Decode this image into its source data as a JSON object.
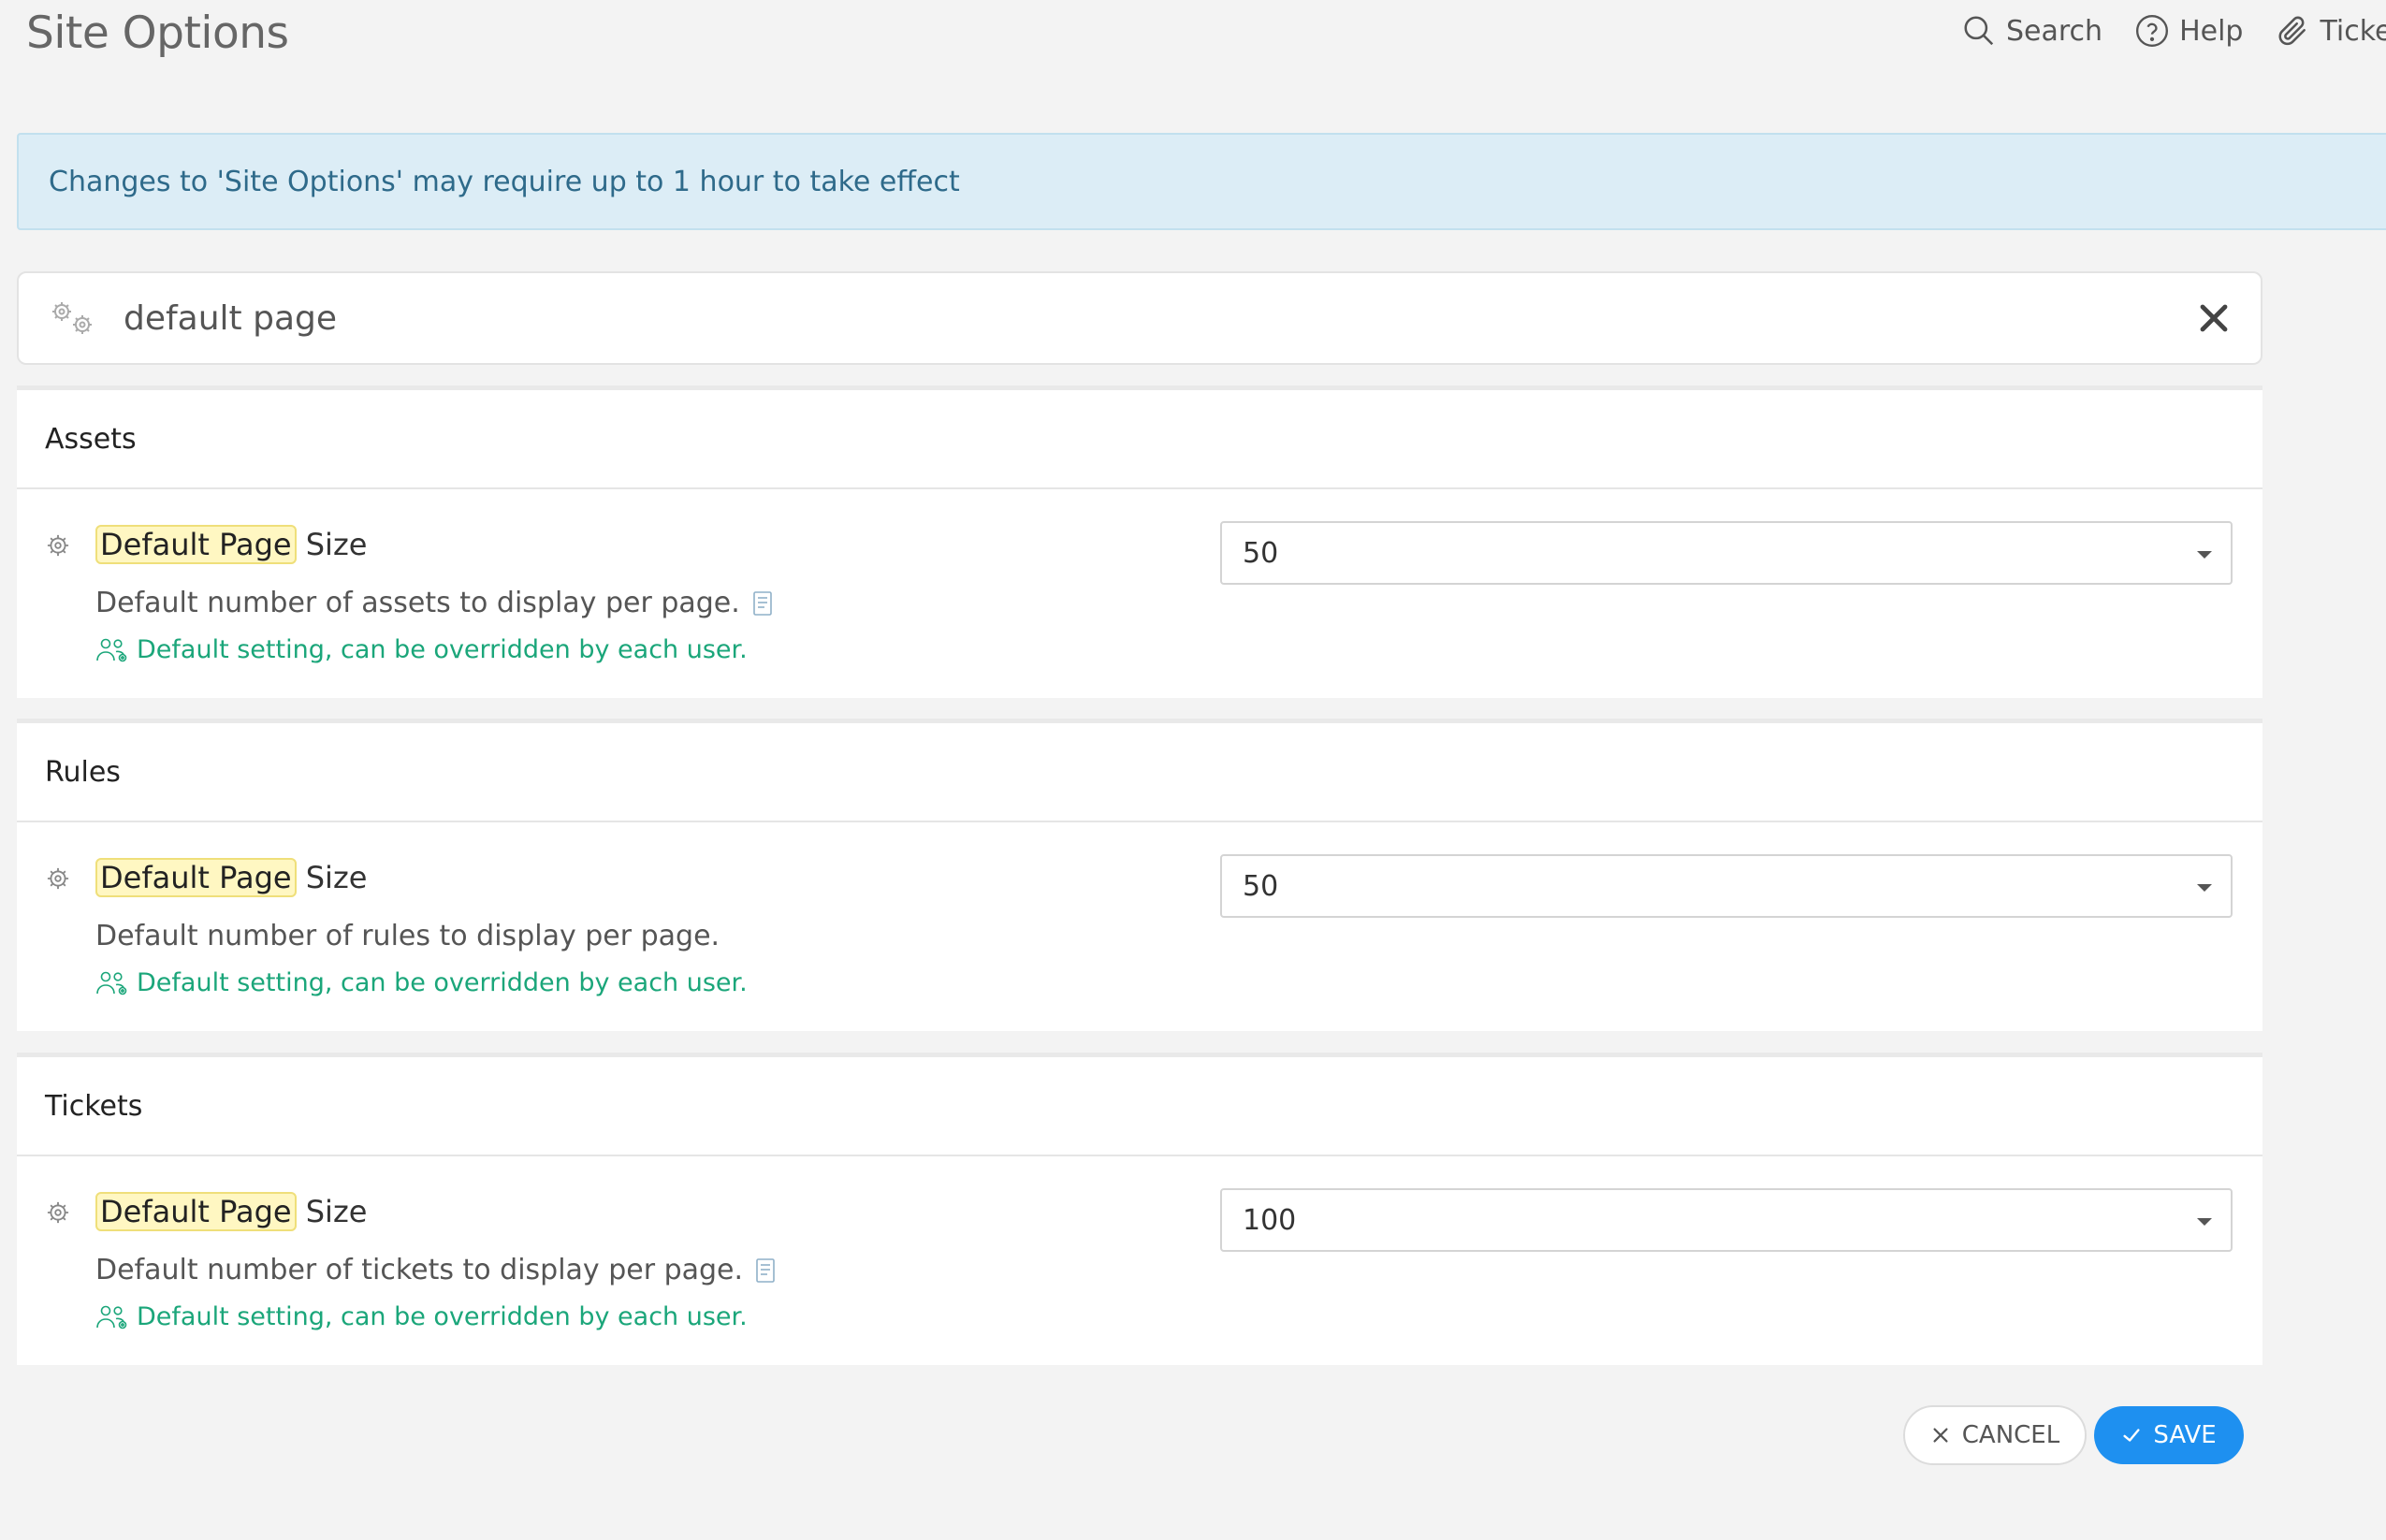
{
  "header": {
    "title": "Site Options",
    "actions": [
      {
        "label": "Search",
        "icon": "search-icon"
      },
      {
        "label": "Help",
        "icon": "help-icon"
      },
      {
        "label": "Ticket",
        "icon": "paperclip-icon"
      }
    ]
  },
  "alert": {
    "message": "Changes to 'Site Options' may require up to 1 hour to take effect"
  },
  "filter": {
    "value": "default page",
    "icon": "gears-icon",
    "clear_icon": "close-icon"
  },
  "sections": [
    {
      "title": "Assets",
      "setting": {
        "title_highlight": "Default Page",
        "title_rest": " Size",
        "description": "Default number of assets to display per page.",
        "note": "Default setting, can be overridden by each user.",
        "value": "50"
      }
    },
    {
      "title": "Rules",
      "setting": {
        "title_highlight": "Default Page",
        "title_rest": " Size",
        "description": "Default number of rules to display per page.",
        "note": "Default setting, can be overridden by each user.",
        "value": "50"
      }
    },
    {
      "title": "Tickets",
      "setting": {
        "title_highlight": "Default Page",
        "title_rest": " Size",
        "description": "Default number of tickets to display per page.",
        "note": "Default setting, can be overridden by each user.",
        "value": "100"
      }
    }
  ],
  "footer": {
    "cancel_label": "CANCEL",
    "save_label": "SAVE"
  },
  "colors": {
    "accent": "#1e90f0",
    "note": "#1ba67a",
    "highlight": "#fff7c2",
    "alert_bg": "#dcedf6"
  }
}
